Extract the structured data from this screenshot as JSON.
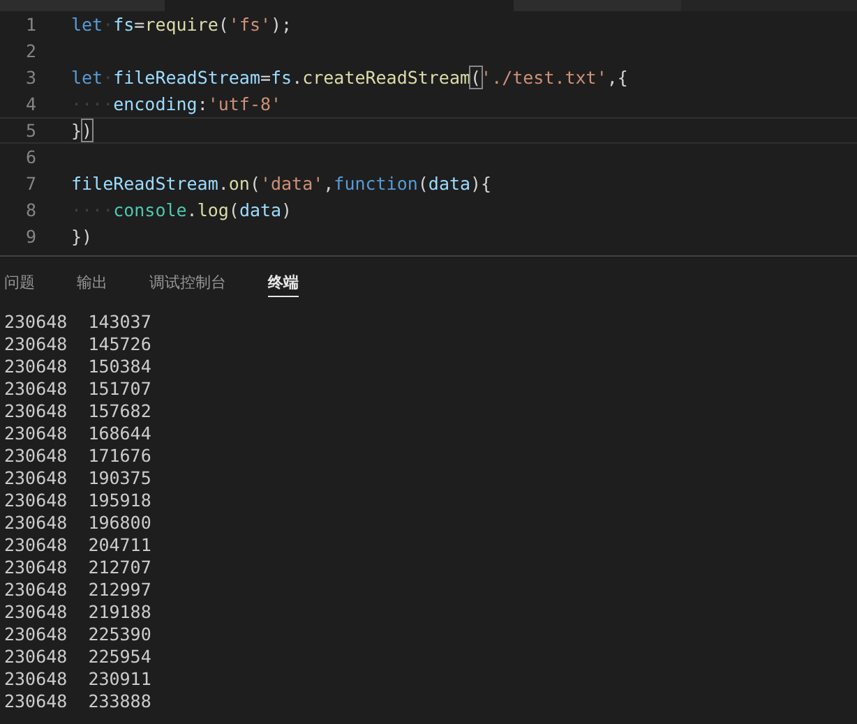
{
  "editor": {
    "lines": [
      {
        "number": "1",
        "current": false,
        "tokens": [
          {
            "kind": "keyword",
            "text": "let"
          },
          {
            "kind": "whitespace",
            "text": "·"
          },
          {
            "kind": "variable",
            "text": "fs"
          },
          {
            "kind": "plain",
            "text": "="
          },
          {
            "kind": "function",
            "text": "require"
          },
          {
            "kind": "plain",
            "text": "("
          },
          {
            "kind": "string",
            "text": "'fs'"
          },
          {
            "kind": "plain",
            "text": ");"
          }
        ]
      },
      {
        "number": "2",
        "current": false
      },
      {
        "number": "3",
        "current": false,
        "tokens": [
          {
            "kind": "keyword",
            "text": "let"
          },
          {
            "kind": "whitespace",
            "text": "·"
          },
          {
            "kind": "variable",
            "text": "fileReadStream"
          },
          {
            "kind": "plain",
            "text": "="
          },
          {
            "kind": "variable",
            "text": "fs"
          },
          {
            "kind": "plain",
            "text": "."
          },
          {
            "kind": "function",
            "text": "createReadStream"
          },
          {
            "kind": "bracket",
            "text": "("
          },
          {
            "kind": "string",
            "text": "'./test.txt'"
          },
          {
            "kind": "plain",
            "text": ",{"
          }
        ]
      },
      {
        "number": "4",
        "current": false,
        "tokens": [
          {
            "kind": "whitespace",
            "text": "····"
          },
          {
            "kind": "variable",
            "text": "encoding"
          },
          {
            "kind": "plain",
            "text": ":"
          },
          {
            "kind": "string",
            "text": "'utf-8'"
          }
        ]
      },
      {
        "number": "5",
        "current": true,
        "tokens": [
          {
            "kind": "plain",
            "text": "}"
          },
          {
            "kind": "bracket",
            "text": ")"
          }
        ]
      },
      {
        "number": "6",
        "current": false
      },
      {
        "number": "7",
        "current": false,
        "tokens": [
          {
            "kind": "variable",
            "text": "fileReadStream"
          },
          {
            "kind": "plain",
            "text": "."
          },
          {
            "kind": "function",
            "text": "on"
          },
          {
            "kind": "plain",
            "text": "("
          },
          {
            "kind": "string",
            "text": "'data'"
          },
          {
            "kind": "plain",
            "text": ","
          },
          {
            "kind": "keyword",
            "text": "function"
          },
          {
            "kind": "plain",
            "text": "("
          },
          {
            "kind": "variable",
            "text": "data"
          },
          {
            "kind": "plain",
            "text": "){"
          }
        ]
      },
      {
        "number": "8",
        "current": false,
        "tokens": [
          {
            "kind": "whitespace",
            "text": "····"
          },
          {
            "kind": "class",
            "text": "console"
          },
          {
            "kind": "plain",
            "text": "."
          },
          {
            "kind": "function",
            "text": "log"
          },
          {
            "kind": "plain",
            "text": "("
          },
          {
            "kind": "variable",
            "text": "data"
          },
          {
            "kind": "plain",
            "text": ")"
          }
        ]
      },
      {
        "number": "9",
        "current": false,
        "tokens": [
          {
            "kind": "plain",
            "text": "})"
          }
        ]
      }
    ]
  },
  "panel": {
    "tabs": [
      {
        "label": "问题",
        "selected": false
      },
      {
        "label": "输出",
        "selected": false
      },
      {
        "label": "调试控制台",
        "selected": false
      },
      {
        "label": "终端",
        "selected": true
      }
    ],
    "terminal_lines": [
      [
        "230648",
        "143037"
      ],
      [
        "230648",
        "145726"
      ],
      [
        "230648",
        "150384"
      ],
      [
        "230648",
        "151707"
      ],
      [
        "230648",
        "157682"
      ],
      [
        "230648",
        "168644"
      ],
      [
        "230648",
        "171676"
      ],
      [
        "230648",
        "190375"
      ],
      [
        "230648",
        "195918"
      ],
      [
        "230648",
        "196800"
      ],
      [
        "230648",
        "204711"
      ],
      [
        "230648",
        "212707"
      ],
      [
        "230648",
        "212997"
      ],
      [
        "230648",
        "219188"
      ],
      [
        "230648",
        "225390"
      ],
      [
        "230648",
        "225954"
      ],
      [
        "230648",
        "230911"
      ],
      [
        "230648",
        "233888"
      ]
    ]
  }
}
